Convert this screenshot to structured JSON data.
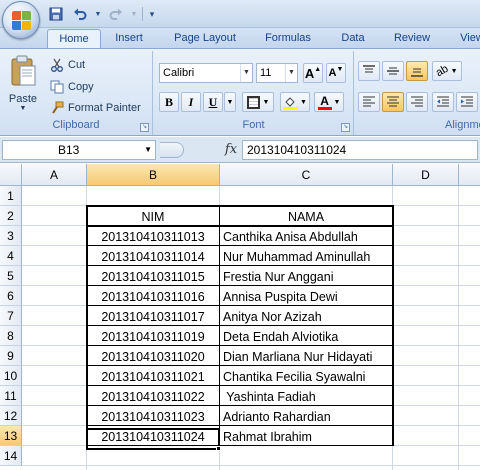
{
  "qat": {
    "save_icon": "save-icon",
    "undo_icon": "undo-icon",
    "redo_icon": "redo-icon",
    "customize_icon": "customize-qat-icon"
  },
  "tabs": [
    "Home",
    "Insert",
    "Page Layout",
    "Formulas",
    "Data",
    "Review",
    "View"
  ],
  "active_tab": "Home",
  "clipboard": {
    "paste": "Paste",
    "cut": "Cut",
    "copy": "Copy",
    "format_painter": "Format Painter",
    "label": "Clipboard"
  },
  "font": {
    "name": "Calibri",
    "size": "11",
    "bold": "B",
    "italic": "I",
    "underline": "U",
    "grow": "A",
    "shrink": "A",
    "label": "Font",
    "font_color": "A",
    "highlight_color": "#ffff00",
    "text_color": "#ff0000"
  },
  "alignment": {
    "label": "Alignme"
  },
  "formula_bar": {
    "name_box": "B13",
    "fx": "fx",
    "value": "201310410311024"
  },
  "columns": [
    "A",
    "B",
    "C",
    "D"
  ],
  "selected_column": "B",
  "rows": [
    "1",
    "2",
    "3",
    "4",
    "5",
    "6",
    "7",
    "8",
    "9",
    "10",
    "11",
    "12",
    "13",
    "14"
  ],
  "selected_row": "13",
  "table": {
    "headers": {
      "nim": "NIM",
      "nama": "NAMA"
    },
    "rows": [
      {
        "nim": "201310410311013",
        "nama": "Canthika Anisa Abdullah"
      },
      {
        "nim": "201310410311014",
        "nama": "Nur Muhammad Aminullah"
      },
      {
        "nim": "201310410311015",
        "nama": "Frestia Nur Anggani"
      },
      {
        "nim": "201310410311016",
        "nama": "Annisa Puspita Dewi"
      },
      {
        "nim": "201310410311017",
        "nama": "Anitya Nor Azizah"
      },
      {
        "nim": "201310410311019",
        "nama": "Deta Endah Alviotika"
      },
      {
        "nim": "201310410311020",
        "nama": "Dian Marliana Nur Hidayati"
      },
      {
        "nim": "201310410311021",
        "nama": "Chantika Fecilia Syawalni"
      },
      {
        "nim": "201310410311022",
        "nama": " Yashinta Fadiah"
      },
      {
        "nim": "201310410311023",
        "nama": "Adrianto Rahardian"
      },
      {
        "nim": "201310410311024",
        "nama": "Rahmat Ibrahim"
      }
    ]
  }
}
